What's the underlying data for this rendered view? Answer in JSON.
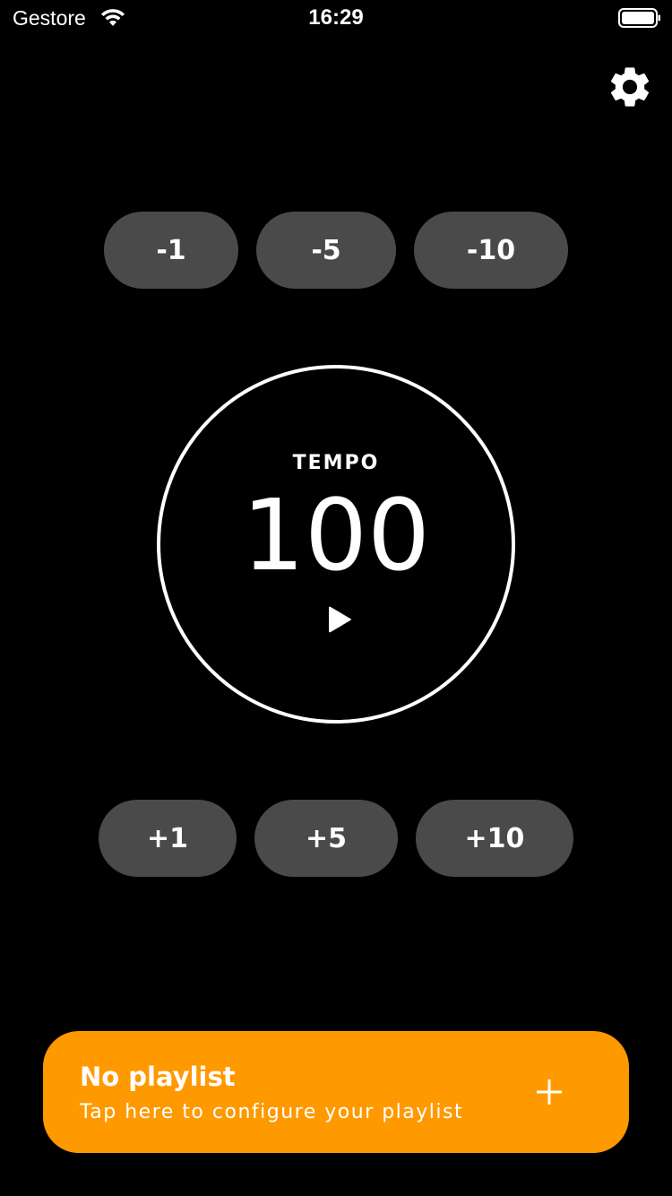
{
  "status_bar": {
    "carrier": "Gestore",
    "time": "16:29",
    "wifi_icon": "wifi-icon",
    "battery_icon": "battery-icon"
  },
  "settings": {
    "icon": "gear-icon"
  },
  "decrement_buttons": [
    {
      "label": "-1"
    },
    {
      "label": "-5"
    },
    {
      "label": "-10"
    }
  ],
  "increment_buttons": [
    {
      "label": "+1"
    },
    {
      "label": "+5"
    },
    {
      "label": "+10"
    }
  ],
  "tempo": {
    "label": "TEMPO",
    "value": "100",
    "play_icon": "play-icon"
  },
  "playlist": {
    "title": "No playlist",
    "subtitle": "Tap here to configure your playlist",
    "add_icon": "plus-icon"
  },
  "colors": {
    "background": "#000000",
    "button_bg": "#4a4a4a",
    "accent": "#ff9900",
    "text": "#ffffff"
  }
}
